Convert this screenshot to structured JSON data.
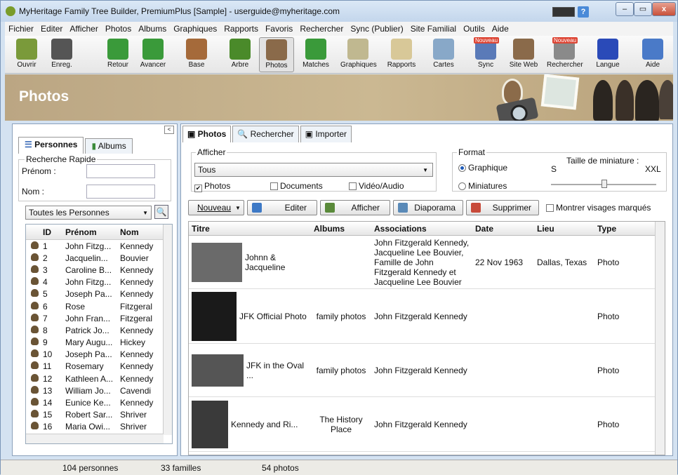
{
  "window": {
    "title": "MyHeritage Family Tree Builder, PremiumPlus [Sample] - userguide@myheritage.com",
    "help": "?",
    "min": "–",
    "max": "▭",
    "close": "x"
  },
  "menu": [
    "Fichier",
    "Editer",
    "Afficher",
    "Photos",
    "Albums",
    "Graphiques",
    "Rapports",
    "Favoris",
    "Rechercher",
    "Sync (Publier)",
    "Site Familial",
    "Outils",
    "Aide"
  ],
  "toolbar": [
    {
      "label": "Ouvrir",
      "icon": "folder-icon",
      "color": "#7a9a3a"
    },
    {
      "label": "Enreg.",
      "icon": "save-icon",
      "color": "#555555"
    },
    {
      "label": "Retour",
      "icon": "back-arrow-icon",
      "color": "#3a9a3a"
    },
    {
      "label": "Avancer",
      "icon": "forward-arrow-icon",
      "color": "#3a9a3a"
    },
    {
      "label": "Base",
      "icon": "home-icon",
      "color": "#a56a3a"
    },
    {
      "label": "Arbre",
      "icon": "tree-icon",
      "color": "#4a8a2a"
    },
    {
      "label": "Photos",
      "icon": "photos-icon",
      "color": "#8a6a4a"
    },
    {
      "label": "Matches",
      "icon": "matches-icon",
      "color": "#3a9a3a"
    },
    {
      "label": "Graphiques",
      "icon": "charts-icon",
      "color": "#c0b890"
    },
    {
      "label": "Rapports",
      "icon": "reports-icon",
      "color": "#d8c898"
    },
    {
      "label": "Cartes",
      "icon": "maps-icon",
      "color": "#88a8c8"
    },
    {
      "label": "Sync",
      "icon": "sync-icon",
      "color": "#5a7ab8"
    },
    {
      "label": "Site Web",
      "icon": "website-icon",
      "color": "#8a6a4a"
    },
    {
      "label": "Rechercher",
      "icon": "search-people-icon",
      "color": "#8a8a8a"
    },
    {
      "label": "Langue",
      "icon": "flag-icon",
      "color": "#2a4ab8"
    },
    {
      "label": "Aide",
      "icon": "help-icon",
      "color": "#4a7ac8"
    }
  ],
  "badge_nouveau": "Nouveau",
  "banner": {
    "title": "Photos"
  },
  "left": {
    "tab_personnes": "Personnes",
    "tab_albums": "Albums",
    "quick_search": "Recherche Rapide",
    "prenom_label": "Prénom :",
    "nom_label": "Nom :",
    "filter": "Toutes les Personnes",
    "columns": [
      "ID",
      "Prénom",
      "Nom"
    ],
    "people": [
      {
        "id": "1",
        "first": "John Fitzg...",
        "last": "Kennedy"
      },
      {
        "id": "2",
        "first": "Jacquelin...",
        "last": "Bouvier"
      },
      {
        "id": "3",
        "first": "Caroline B...",
        "last": "Kennedy"
      },
      {
        "id": "4",
        "first": "John Fitzg...",
        "last": "Kennedy"
      },
      {
        "id": "5",
        "first": "Joseph Pa...",
        "last": "Kennedy"
      },
      {
        "id": "6",
        "first": "Rose",
        "last": "Fitzgeral"
      },
      {
        "id": "7",
        "first": "John Fran...",
        "last": "Fitzgeral"
      },
      {
        "id": "8",
        "first": "Patrick Jo...",
        "last": "Kennedy"
      },
      {
        "id": "9",
        "first": "Mary Augu...",
        "last": "Hickey"
      },
      {
        "id": "10",
        "first": "Joseph Pa...",
        "last": "Kennedy"
      },
      {
        "id": "11",
        "first": "Rosemary",
        "last": "Kennedy"
      },
      {
        "id": "12",
        "first": "Kathleen A...",
        "last": "Kennedy"
      },
      {
        "id": "13",
        "first": "William Jo...",
        "last": "Cavendi"
      },
      {
        "id": "14",
        "first": "Eunice Ke...",
        "last": "Kennedy"
      },
      {
        "id": "15",
        "first": "Robert Sar...",
        "last": "Shriver"
      },
      {
        "id": "16",
        "first": "Maria Owi...",
        "last": "Shriver"
      }
    ]
  },
  "right": {
    "tabs": [
      "Photos",
      "Rechercher",
      "Importer"
    ],
    "afficher_legend": "Afficher",
    "afficher_value": "Tous",
    "chk_photos": "Photos",
    "chk_documents": "Documents",
    "chk_video": "Vidéo/Audio",
    "format_legend": "Format",
    "radio_graphique": "Graphique",
    "radio_miniatures": "Miniatures",
    "taille_label": "Taille de miniature :",
    "size_s": "S",
    "size_xxl": "XXL",
    "buttons": {
      "nouveau": "Nouveau",
      "editer": "Editer",
      "afficher": "Afficher",
      "diaporama": "Diaporama",
      "supprimer": "Supprimer",
      "montrer": "Montrer visages marqués"
    },
    "columns": [
      "Titre",
      "Albums",
      "Associations",
      "Date",
      "Lieu",
      "Type"
    ],
    "photos": [
      {
        "title": "Johnn & Jacqueline",
        "album": "",
        "assoc": "John Fitzgerald Kennedy, Jacqueline Lee Bouvier, Famille de John Fitzgerald Kennedy et Jacqueline Lee Bouvier",
        "date": "22 Nov 1963",
        "place": "Dallas, Texas",
        "type": "Photo"
      },
      {
        "title": "JFK Official Photo",
        "album": "family photos",
        "assoc": "John Fitzgerald Kennedy",
        "date": "",
        "place": "",
        "type": "Photo"
      },
      {
        "title": "JFK in the Oval ...",
        "album": "family photos",
        "assoc": "John Fitzgerald Kennedy",
        "date": "",
        "place": "",
        "type": "Photo"
      },
      {
        "title": "Kennedy and Ri...",
        "album": "The History Place",
        "assoc": "John Fitzgerald Kennedy",
        "date": "",
        "place": "",
        "type": "Photo"
      }
    ]
  },
  "status": {
    "persons": "104 personnes",
    "families": "33 familles",
    "photos": "54 photos"
  }
}
